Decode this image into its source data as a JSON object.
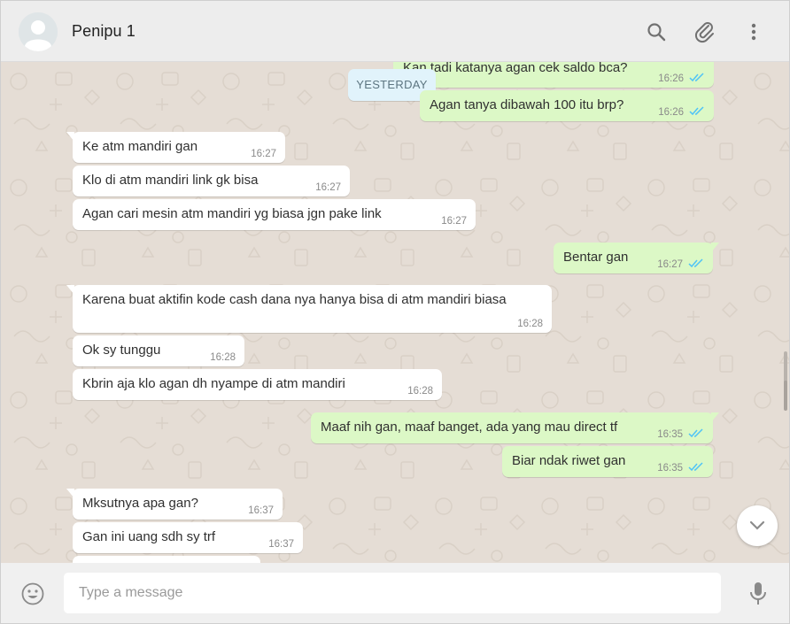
{
  "header": {
    "contact_name": "Penipu 1"
  },
  "chat": {
    "date_divider": "YESTERDAY",
    "messages": [
      {
        "dir": "out",
        "text": "Kan tadi katanya agan cek saldo bca?",
        "time": "16:26",
        "status": "read"
      },
      {
        "dir": "out",
        "text": "Agan tanya dibawah 100 itu brp?",
        "time": "16:26",
        "status": "read"
      },
      {
        "dir": "in",
        "text": "Ke atm mandiri gan",
        "time": "16:27"
      },
      {
        "dir": "in",
        "text": "Klo di atm mandiri link gk bisa",
        "time": "16:27"
      },
      {
        "dir": "in",
        "text": "Agan cari mesin atm mandiri yg biasa jgn pake link",
        "time": "16:27"
      },
      {
        "dir": "out",
        "text": "Bentar gan",
        "time": "16:27",
        "status": "read"
      },
      {
        "dir": "in",
        "text": "Karena buat aktifin kode cash dana nya hanya bisa di atm mandiri biasa",
        "time": "16:28"
      },
      {
        "dir": "in",
        "text": "Ok sy tunggu",
        "time": "16:28"
      },
      {
        "dir": "in",
        "text": "Kbrin aja klo agan dh nyampe di atm mandiri",
        "time": "16:28"
      },
      {
        "dir": "out",
        "text": "Maaf nih gan, maaf banget, ada yang mau direct tf",
        "time": "16:35",
        "status": "read"
      },
      {
        "dir": "out",
        "text": "Biar ndak riwet gan",
        "time": "16:35",
        "status": "read"
      },
      {
        "dir": "in",
        "text": "Mksutnya apa gan?",
        "time": "16:37"
      },
      {
        "dir": "in",
        "text": "Gan ini uang sdh sy trf",
        "time": "16:37"
      }
    ]
  },
  "footer": {
    "input_placeholder": "Type a message"
  },
  "icons": {
    "header": [
      "search-icon",
      "attach-icon",
      "menu-icon"
    ],
    "footer": [
      "emoji-icon",
      "mic-icon"
    ],
    "scroll": "chevron-down-icon"
  },
  "colors": {
    "incoming_bubble": "#ffffff",
    "outgoing_bubble": "#dcf8c6",
    "chat_background": "#e5ddd5",
    "read_ticks": "#4fc3f7",
    "header_background": "#ededed"
  }
}
